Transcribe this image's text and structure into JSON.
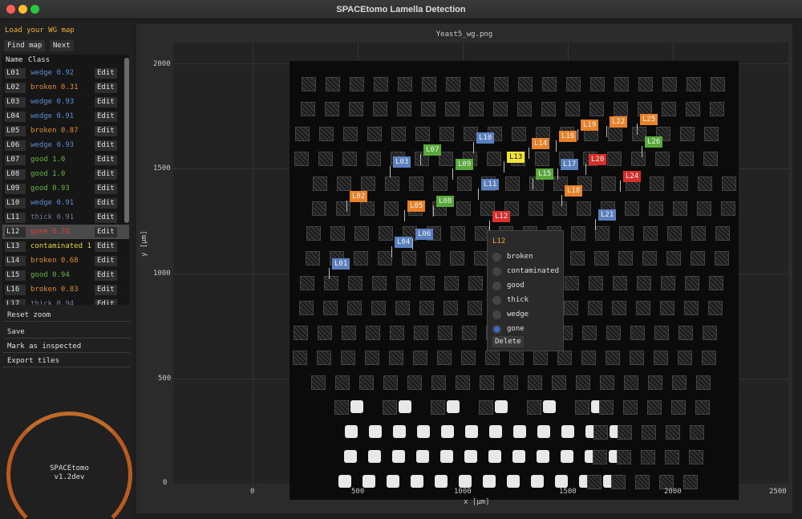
{
  "window": {
    "title": "SPACEtomo Lamella Detection"
  },
  "sidebar": {
    "load_label": "Load your WG map",
    "find_map": "Find map",
    "next": "Next",
    "col_name": "Name",
    "col_class": "Class",
    "edit_label": "Edit",
    "rows": [
      {
        "name": "L01",
        "cls": "wedge 0.92",
        "k": "wedge"
      },
      {
        "name": "L02",
        "cls": "broken 0.31",
        "k": "broken"
      },
      {
        "name": "L03",
        "cls": "wedge 0.93",
        "k": "wedge"
      },
      {
        "name": "L04",
        "cls": "wedge 0.91",
        "k": "wedge"
      },
      {
        "name": "L05",
        "cls": "broken 0.87",
        "k": "broken"
      },
      {
        "name": "L06",
        "cls": "wedge 0.93",
        "k": "wedge"
      },
      {
        "name": "L07",
        "cls": "good 1.0",
        "k": "good"
      },
      {
        "name": "L08",
        "cls": "good 1.0",
        "k": "good"
      },
      {
        "name": "L09",
        "cls": "good 0.93",
        "k": "good"
      },
      {
        "name": "L10",
        "cls": "wedge 0.91",
        "k": "wedge"
      },
      {
        "name": "L11",
        "cls": "thick 0.91",
        "k": "thick"
      },
      {
        "name": "L12",
        "cls": "gone 0.78",
        "k": "gone"
      },
      {
        "name": "L13",
        "cls": "contaminated 1",
        "k": "contaminated"
      },
      {
        "name": "L14",
        "cls": "broken 0.68",
        "k": "broken"
      },
      {
        "name": "L15",
        "cls": "good 0.94",
        "k": "good"
      },
      {
        "name": "L16",
        "cls": "broken 0.83",
        "k": "broken"
      },
      {
        "name": "L17",
        "cls": "thick 0.94",
        "k": "thick"
      }
    ],
    "selected_row": "L12",
    "reset_zoom": "Reset zoom",
    "save": "Save",
    "mark_inspected": "Mark as inspected",
    "export_tiles": "Export tiles"
  },
  "logo": {
    "name": "SPACEtomo",
    "version": "v1.2dev"
  },
  "plot": {
    "title": "Yeast5_wg.png",
    "xlabel": "x [μm]",
    "ylabel": "y [μm]",
    "xticks": [
      "0",
      "500",
      "1000",
      "1500",
      "2000",
      "2500"
    ],
    "yticks": [
      "2000",
      "1500",
      "1000",
      "500",
      "0"
    ]
  },
  "lamellae": [
    {
      "name": "L01",
      "k": "wedge"
    },
    {
      "name": "L02",
      "k": "broken"
    },
    {
      "name": "L03",
      "k": "wedge"
    },
    {
      "name": "L04",
      "k": "wedge"
    },
    {
      "name": "L05",
      "k": "broken"
    },
    {
      "name": "L06",
      "k": "wedge"
    },
    {
      "name": "L07",
      "k": "good"
    },
    {
      "name": "L08",
      "k": "good"
    },
    {
      "name": "L09",
      "k": "good"
    },
    {
      "name": "L10",
      "k": "wedge"
    },
    {
      "name": "L11",
      "k": "wedge"
    },
    {
      "name": "L12",
      "k": "gone"
    },
    {
      "name": "L13",
      "k": "contaminated"
    },
    {
      "name": "L14",
      "k": "broken"
    },
    {
      "name": "L15",
      "k": "good"
    },
    {
      "name": "L16",
      "k": "broken"
    },
    {
      "name": "L17",
      "k": "wedge"
    },
    {
      "name": "L18",
      "k": "broken"
    },
    {
      "name": "L19",
      "k": "broken"
    },
    {
      "name": "L20",
      "k": "gone"
    },
    {
      "name": "L21",
      "k": "wedge"
    },
    {
      "name": "L22",
      "k": "broken"
    },
    {
      "name": "L24",
      "k": "gone"
    },
    {
      "name": "L25",
      "k": "broken"
    },
    {
      "name": "L26",
      "k": "good"
    }
  ],
  "popup": {
    "title": "L12",
    "options": [
      "broken",
      "contaminated",
      "good",
      "thick",
      "wedge",
      "gone"
    ],
    "selected": "gone",
    "delete": "Delete"
  },
  "colors": {
    "wedge": "#5b80c0",
    "broken": "#e8822a",
    "good": "#5aa83c",
    "gone": "#d6302a",
    "contaminated": "#f2e43a",
    "thick": "#6e7e96",
    "accent": "#f0b030"
  }
}
